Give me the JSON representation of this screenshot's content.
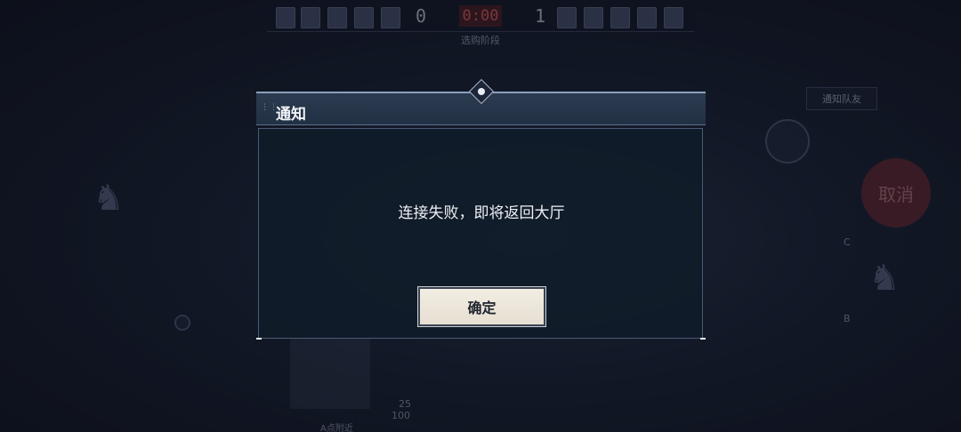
{
  "hud": {
    "score_left": "0",
    "timer": "0:00",
    "score_right": "1",
    "phase_label": "选购阶段",
    "notify_team": "通知队友",
    "cancel": "取消",
    "hp_value": "100",
    "ammo_value": "25",
    "side_c": "C",
    "side_b": "B",
    "minimap_label": "A点附近"
  },
  "dialog": {
    "title": "通知",
    "message": "连接失败，即将返回大厅",
    "confirm_label": "确定"
  },
  "colors": {
    "backdrop": "#14192a",
    "dialog_header": "#2c3b50",
    "confirm_bg": "#f2ede3",
    "timer_red": "#d45b5b"
  }
}
